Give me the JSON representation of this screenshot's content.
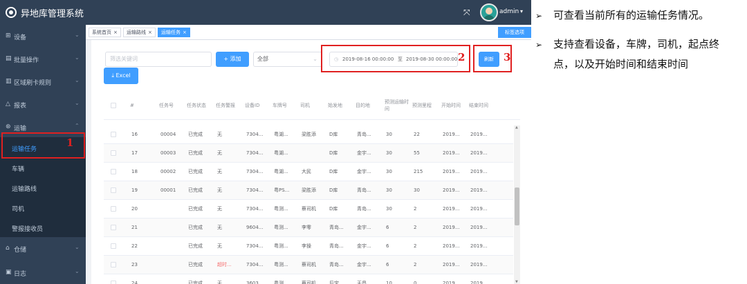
{
  "app": {
    "title": "异地库管理系统",
    "user": "admin",
    "colors": {
      "sidebar": "#304156",
      "primary": "#409eff",
      "annotation": "#e02020"
    }
  },
  "topbar": {
    "fullscreen_icon": "fullscreen-icon",
    "user_caret": "▾"
  },
  "sidebar": {
    "items": [
      {
        "label": "设备",
        "icon": "⊞"
      },
      {
        "label": "批量操作",
        "icon": "▤"
      },
      {
        "label": "区域刷卡规则",
        "icon": "▥"
      },
      {
        "label": "报表",
        "icon": "△"
      },
      {
        "label": "运输",
        "icon": "⊛"
      },
      {
        "label": "仓储",
        "icon": "⌂"
      },
      {
        "label": "日志",
        "icon": "▣"
      }
    ],
    "subitems": [
      {
        "label": "运输任务"
      },
      {
        "label": "车辆"
      },
      {
        "label": "运输路线"
      },
      {
        "label": "司机"
      },
      {
        "label": "警报接收员"
      }
    ]
  },
  "tags": [
    {
      "label": "系统首页"
    },
    {
      "label": "运输路线"
    },
    {
      "label": "运输任务"
    }
  ],
  "tags_menu": "标签选项",
  "toolbar": {
    "keyword_placeholder": "筛选关键词",
    "add_label": "+ 添加",
    "status_value": "全部",
    "date_start": "2019-08-16 00:00:00",
    "date_sep": "至",
    "date_end": "2019-08-30 00:00:00",
    "refresh_label": "刷新",
    "excel_label": "⤓ Excel"
  },
  "annotations": [
    "1",
    "2",
    "3"
  ],
  "table": {
    "columns": [
      "#",
      "任务号",
      "任务状态",
      "任务警报",
      "设备ID",
      "车牌号",
      "司机",
      "始发地",
      "目的地",
      "预测运输时间",
      "预测里程",
      "开始时间",
      "结束时间"
    ],
    "rows": [
      [
        "16",
        "00004",
        "已完成",
        "无",
        "7304...",
        "粤湖...",
        "梁胜添",
        "D库",
        "青岛...",
        "30",
        "22",
        "2019...",
        "2019..."
      ],
      [
        "17",
        "00003",
        "已完成",
        "无",
        "7304...",
        "粤湖...",
        "",
        "D库",
        "金宇...",
        "30",
        "55",
        "2019...",
        "2019..."
      ],
      [
        "18",
        "00002",
        "已完成",
        "无",
        "7304...",
        "粤湖...",
        "大民",
        "D库",
        "金宇...",
        "30",
        "215",
        "2019...",
        "2019..."
      ],
      [
        "19",
        "00001",
        "已完成",
        "无",
        "7304...",
        "粤PS...",
        "梁胜添",
        "D库",
        "青岛...",
        "30",
        "30",
        "2019...",
        "2019..."
      ],
      [
        "20",
        "",
        "已完成",
        "无",
        "7304...",
        "粤测...",
        "蔡司机",
        "D库",
        "青岛...",
        "30",
        "2",
        "2019...",
        "2019..."
      ],
      [
        "21",
        "",
        "已完成",
        "无",
        "9604...",
        "粤测...",
        "李零",
        "青岛...",
        "金宇...",
        "6",
        "2",
        "2019...",
        "2019..."
      ],
      [
        "22",
        "",
        "已完成",
        "无",
        "7304...",
        "粤测...",
        "李操",
        "青岛...",
        "金宇...",
        "6",
        "2",
        "2019...",
        "2019..."
      ],
      [
        "23",
        "",
        "已完成",
        "超时...",
        "7304...",
        "粤测...",
        "蔡司机",
        "青岛...",
        "金宇...",
        "6",
        "2",
        "2019...",
        "2019..."
      ],
      [
        "24",
        "",
        "已完成",
        "无",
        "3603...",
        "粤测...",
        "蔡司机",
        "后宝...",
        "天昌...",
        "10",
        "0",
        "2019...",
        "2019..."
      ]
    ],
    "warn_rows": [
      7
    ]
  },
  "notes": [
    {
      "bullet": "➢",
      "lines": [
        "可查看当前所有的运输任务情况。"
      ]
    },
    {
      "bullet": "➢",
      "lines": [
        "支持查看设备，车牌，司机，起点终",
        "点，以及开始时间和结束时间"
      ]
    }
  ]
}
